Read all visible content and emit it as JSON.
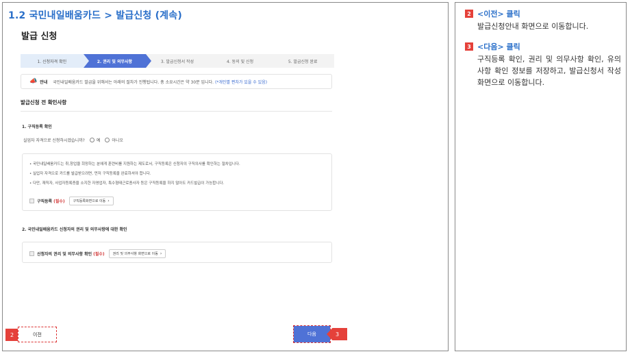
{
  "header": {
    "title": "1.2 국민내일배움카드 > 발급신청 (계속)",
    "subtitle": "발급 신청"
  },
  "steps": [
    {
      "label": "1. 신청자격 확인",
      "state": "done"
    },
    {
      "label": "2. 권리 및 의무사항",
      "state": "active"
    },
    {
      "label": "3. 발급신청서 작성",
      "state": "todo"
    },
    {
      "label": "4. 동의 및 신청",
      "state": "todo"
    },
    {
      "label": "5. 발급신청 완료",
      "state": "todo"
    }
  ],
  "notice": {
    "tag": "안내",
    "text": "국민내일배움카드 발급을 위해서는 아래의 절차가 진행됩니다. 총 소요시간은 약 30분 입니다.",
    "sub": "(*개인별 편차가 있을 수 있음)"
  },
  "section": {
    "title": "발급신청 전 확인사항"
  },
  "q1": {
    "title": "1. 구직등록 확인",
    "question": "실업자 자격으로 신청하시겠습니까?",
    "yes": "예",
    "no": "아니오",
    "bullets": [
      "• 국민내일배움카드는 취,창업을 희망하는 분에게 훈련비를 지원하는 제도로서, 구직등록은 신청자의 구직의사를 확인하는 절차입니다.",
      "• 실업자 자격으로 카드를 발급받으려면, 먼저 구직등록을 완료하셔야 합니다.",
      "• 다만, 재직자, 사업자등록증을 소지한 자영업자, 특수형태근로종사자 등은 구직등록을 하지 않아도 카드발급이 가능합니다."
    ],
    "check_label": "구직등록",
    "required": "(필수)",
    "button": "구직등록화면으로 이동"
  },
  "q2": {
    "title": "2. 국민내일배움카드 신청자의 권리 및 의무사항에 대한 확인",
    "check_label": "신청자의 권리 및 의무사항 확인",
    "required": "(필수)",
    "button": "권리 및 의무사항 화면으로 이동"
  },
  "footer": {
    "prev": "이전",
    "next": "다음",
    "marker_prev": "2",
    "marker_next": "3"
  },
  "notes": [
    {
      "num": "2",
      "head": "<이전> 클릭",
      "body": "발급신청안내 화면으로 이동합니다."
    },
    {
      "num": "3",
      "head": "<다음> 클릭",
      "body": "구직등록 확인, 권리 및 의무사항 확인, 유의사항 확인 정보를 저장하고, 발급신청서 작성 화면으로 이동합니다."
    }
  ],
  "colors": {
    "accent": "#2a6fc9",
    "active_step": "#4f72d6",
    "marker": "#e5413a",
    "required": "#d23a3a"
  }
}
